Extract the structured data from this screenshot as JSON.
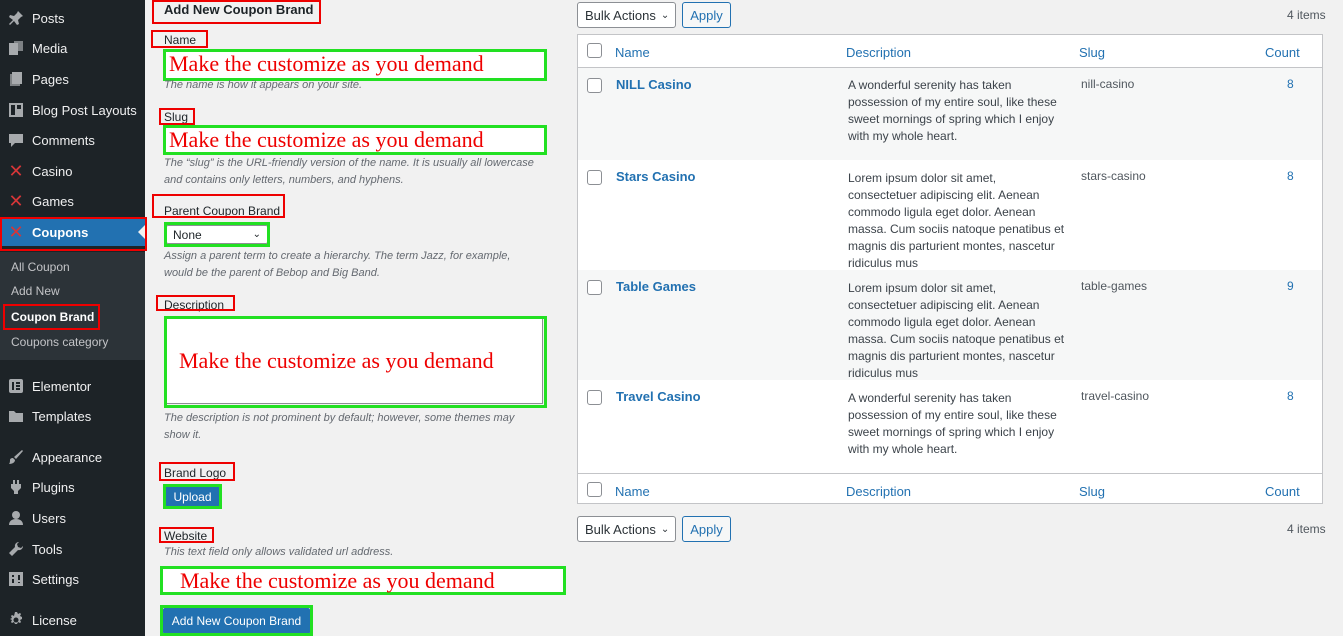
{
  "sidebar": {
    "items": [
      {
        "label": "Posts",
        "icon": "pin-icon"
      },
      {
        "label": "Media",
        "icon": "media-icon"
      },
      {
        "label": "Pages",
        "icon": "pages-icon"
      },
      {
        "label": "Blog Post Layouts",
        "icon": "layout-icon"
      },
      {
        "label": "Comments",
        "icon": "comment-icon"
      },
      {
        "label": "Casino",
        "icon": "x-icon"
      },
      {
        "label": "Games",
        "icon": "x-icon"
      },
      {
        "label": "Coupons",
        "icon": "x-icon"
      },
      {
        "label": "Elementor",
        "icon": "elementor-icon"
      },
      {
        "label": "Templates",
        "icon": "folder-icon"
      },
      {
        "label": "Appearance",
        "icon": "brush-icon"
      },
      {
        "label": "Plugins",
        "icon": "plug-icon"
      },
      {
        "label": "Users",
        "icon": "user-icon"
      },
      {
        "label": "Tools",
        "icon": "wrench-icon"
      },
      {
        "label": "Settings",
        "icon": "settings-icon"
      },
      {
        "label": "License",
        "icon": "gear-icon"
      }
    ],
    "submenu": [
      "All Coupon",
      "Add New",
      "Coupon Brand",
      "Coupons category"
    ]
  },
  "form": {
    "heading": "Add New Coupon Brand",
    "name_label": "Name",
    "name_help": "The name is how it appears on your site.",
    "slug_label": "Slug",
    "slug_help_1": "The “slug” is the URL-friendly version of the name. It is usually all lowercase",
    "slug_help_2": "and contains only letters, numbers, and hyphens.",
    "parent_label": "Parent Coupon Brand",
    "parent_value": "None",
    "parent_help_1": "Assign a parent term to create a hierarchy. The term Jazz, for example,",
    "parent_help_2": "would be the parent of Bebop and Big Band.",
    "description_label": "Description",
    "description_help_1": "The description is not prominent by default; however, some themes may",
    "description_help_2": "show it.",
    "logo_label": "Brand Logo",
    "upload_label": "Upload",
    "website_label": "Website",
    "website_help": "This text field only allows validated url address.",
    "submit_label": "Add New Coupon Brand",
    "annotation": "Make the customize as you demand"
  },
  "table": {
    "bulk_actions": "Bulk Actions",
    "apply": "Apply",
    "items_count": "4 items",
    "headers": {
      "name": "Name",
      "description": "Description",
      "slug": "Slug",
      "count": "Count"
    },
    "rows": [
      {
        "name": "NILL Casino",
        "description": "A wonderful serenity has taken possession of my entire soul, like these sweet mornings of spring which I enjoy with my whole heart.",
        "slug": "nill-casino",
        "count": "8"
      },
      {
        "name": "Stars Casino",
        "description": "Lorem ipsum dolor sit amet, consectetuer adipiscing elit. Aenean commodo ligula eget dolor. Aenean massa. Cum sociis natoque penatibus et magnis dis parturient montes, nascetur ridiculus mus",
        "slug": "stars-casino",
        "count": "8"
      },
      {
        "name": "Table Games",
        "description": "Lorem ipsum dolor sit amet, consectetuer adipiscing elit. Aenean commodo ligula eget dolor. Aenean massa. Cum sociis natoque penatibus et magnis dis parturient montes, nascetur ridiculus mus",
        "slug": "table-games",
        "count": "9"
      },
      {
        "name": "Travel Casino",
        "description": "A wonderful serenity has taken possession of my entire soul, like these sweet mornings of spring which I enjoy with my whole heart.",
        "slug": "travel-casino",
        "count": "8"
      }
    ]
  },
  "colors": {
    "accent": "#2271b1",
    "annotation_red": "#ee0000",
    "annotation_green": "#22e022",
    "sidebar_bg": "#1d2327"
  }
}
